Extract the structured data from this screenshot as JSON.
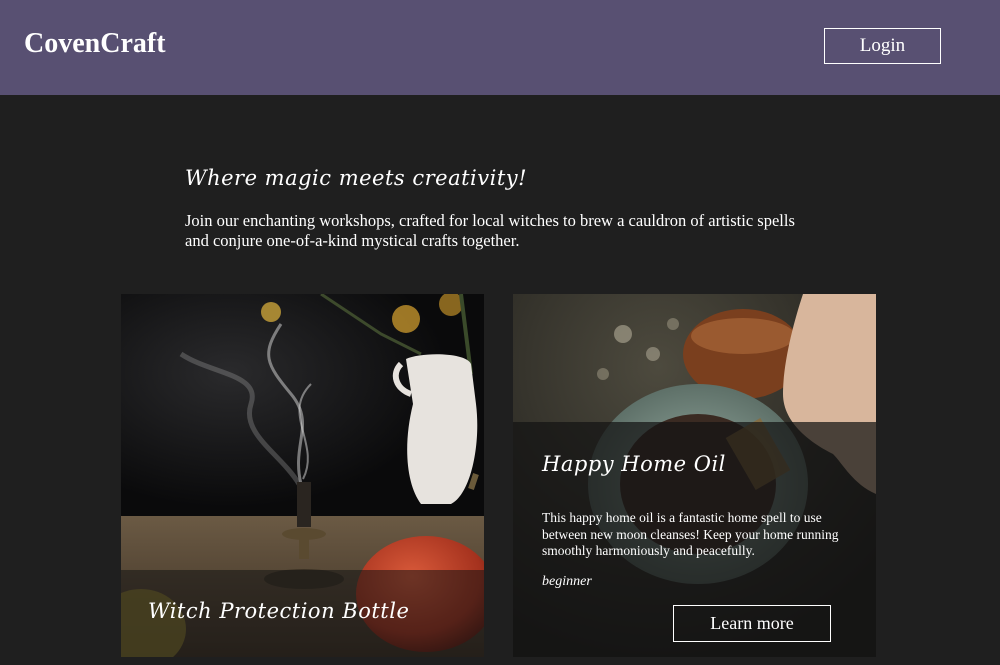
{
  "header": {
    "brand": "CovenCraft",
    "login_label": "Login"
  },
  "hero": {
    "tagline": "Where magic meets creativity!",
    "intro": "Join our enchanting workshops, crafted for local witches to brew a cauldron of artistic spells and conjure one-of-a-kind mystical crafts together."
  },
  "cards": [
    {
      "title": "Witch Protection Bottle",
      "image": "candle-and-pumpkin-photo"
    },
    {
      "title": "Happy Home Oil",
      "description": "This happy home oil is a fantastic home spell to use between new moon cleanses! Keep your home running smoothly harmoniously and peacefully.",
      "level": "beginner",
      "button_label": "Learn more",
      "image": "oil-pouring-bowl-photo"
    }
  ],
  "colors": {
    "header_bg": "#585072",
    "page_bg": "#1f1f1f",
    "text": "#ffffff"
  }
}
